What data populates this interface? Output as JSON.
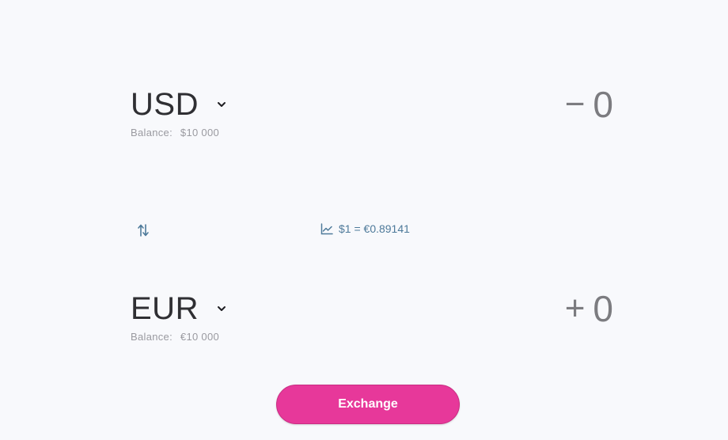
{
  "from": {
    "currency": "USD",
    "balance_label": "Balance:",
    "balance_value": "$10 000",
    "sign": "−",
    "amount": "0"
  },
  "to": {
    "currency": "EUR",
    "balance_label": "Balance:",
    "balance_value": "€10 000",
    "sign": "+",
    "amount": "0"
  },
  "rate": {
    "text": "$1 = €0.89141",
    "icon": "trend-chart-icon"
  },
  "swap": {
    "icon": "swap-arrows-icon"
  },
  "exchange_button": {
    "label": "Exchange"
  },
  "colors": {
    "background": "#f8f9fc",
    "accent": "#e7389a",
    "rate_text": "#4e7a9a",
    "primary_text": "#2f2f33",
    "muted_text": "#9a9aa0",
    "amount_text": "#7c7c80"
  }
}
